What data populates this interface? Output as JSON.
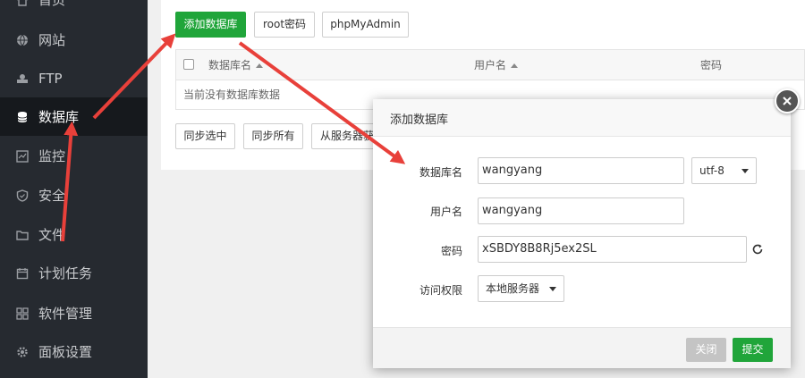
{
  "sidebar": {
    "items": [
      {
        "label": "首页",
        "icon": "home-icon"
      },
      {
        "label": "网站",
        "icon": "globe-icon"
      },
      {
        "label": "FTP",
        "icon": "ftp-icon"
      },
      {
        "label": "数据库",
        "icon": "database-icon",
        "active": true
      },
      {
        "label": "监控",
        "icon": "monitor-icon"
      },
      {
        "label": "安全",
        "icon": "shield-icon"
      },
      {
        "label": "文件",
        "icon": "folder-icon"
      },
      {
        "label": "计划任务",
        "icon": "calendar-icon"
      },
      {
        "label": "软件管理",
        "icon": "grid-icon"
      },
      {
        "label": "面板设置",
        "icon": "gear-icon"
      }
    ]
  },
  "toolbar": {
    "add_db": "添加数据库",
    "root_pwd": "root密码",
    "phpmyadmin": "phpMyAdmin"
  },
  "table": {
    "columns": [
      "数据库名",
      "用户名",
      "密码"
    ],
    "empty": "当前没有数据库数据"
  },
  "bottom_buttons": {
    "sync_selected": "同步选中",
    "sync_all": "同步所有",
    "from_server": "从服务器获"
  },
  "modal": {
    "title": "添加数据库",
    "fields": {
      "dbname_label": "数据库名",
      "dbname_value": "wangyang",
      "charset_value": "utf-8",
      "username_label": "用户名",
      "username_value": "wangyang",
      "password_label": "密码",
      "password_value": "xSBDY8B8Rj5ex2SL",
      "access_label": "访问权限",
      "access_value": "本地服务器"
    },
    "close_label": "关闭",
    "submit_label": "提交"
  },
  "colors": {
    "accent": "#20a53a",
    "sidebar_bg": "#262a30",
    "annotation_arrow": "#e8403a"
  }
}
